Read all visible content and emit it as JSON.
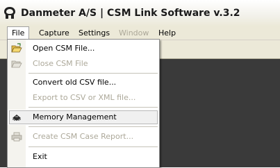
{
  "window": {
    "title": "Danmeter A/S | CSM Link Software v.3.2"
  },
  "menubar": {
    "items": [
      {
        "label": "File",
        "state": "open"
      },
      {
        "label": "Capture",
        "state": "enabled"
      },
      {
        "label": "Settings",
        "state": "enabled"
      },
      {
        "label": "Window",
        "state": "disabled"
      },
      {
        "label": "Help",
        "state": "enabled"
      }
    ]
  },
  "file_menu": {
    "items": [
      {
        "label": "Open CSM File...",
        "icon": "open-folder-icon",
        "enabled": true
      },
      {
        "label": "Close CSM File",
        "icon": "close-folder-icon",
        "enabled": false
      },
      {
        "label": "Convert old CSV file...",
        "enabled": true
      },
      {
        "label": "Export to CSV or XML file...",
        "enabled": false
      },
      {
        "label": "Memory Management",
        "icon": "memory-chip-icon",
        "enabled": true,
        "highlighted": true
      },
      {
        "label": "Create CSM Case Report...",
        "icon": "printer-icon",
        "enabled": false
      },
      {
        "label": "Exit",
        "enabled": true
      }
    ]
  },
  "colors": {
    "menu_disabled": "#aca899",
    "client_background": "#3a3a3a",
    "chrome": "#ece9d8"
  }
}
